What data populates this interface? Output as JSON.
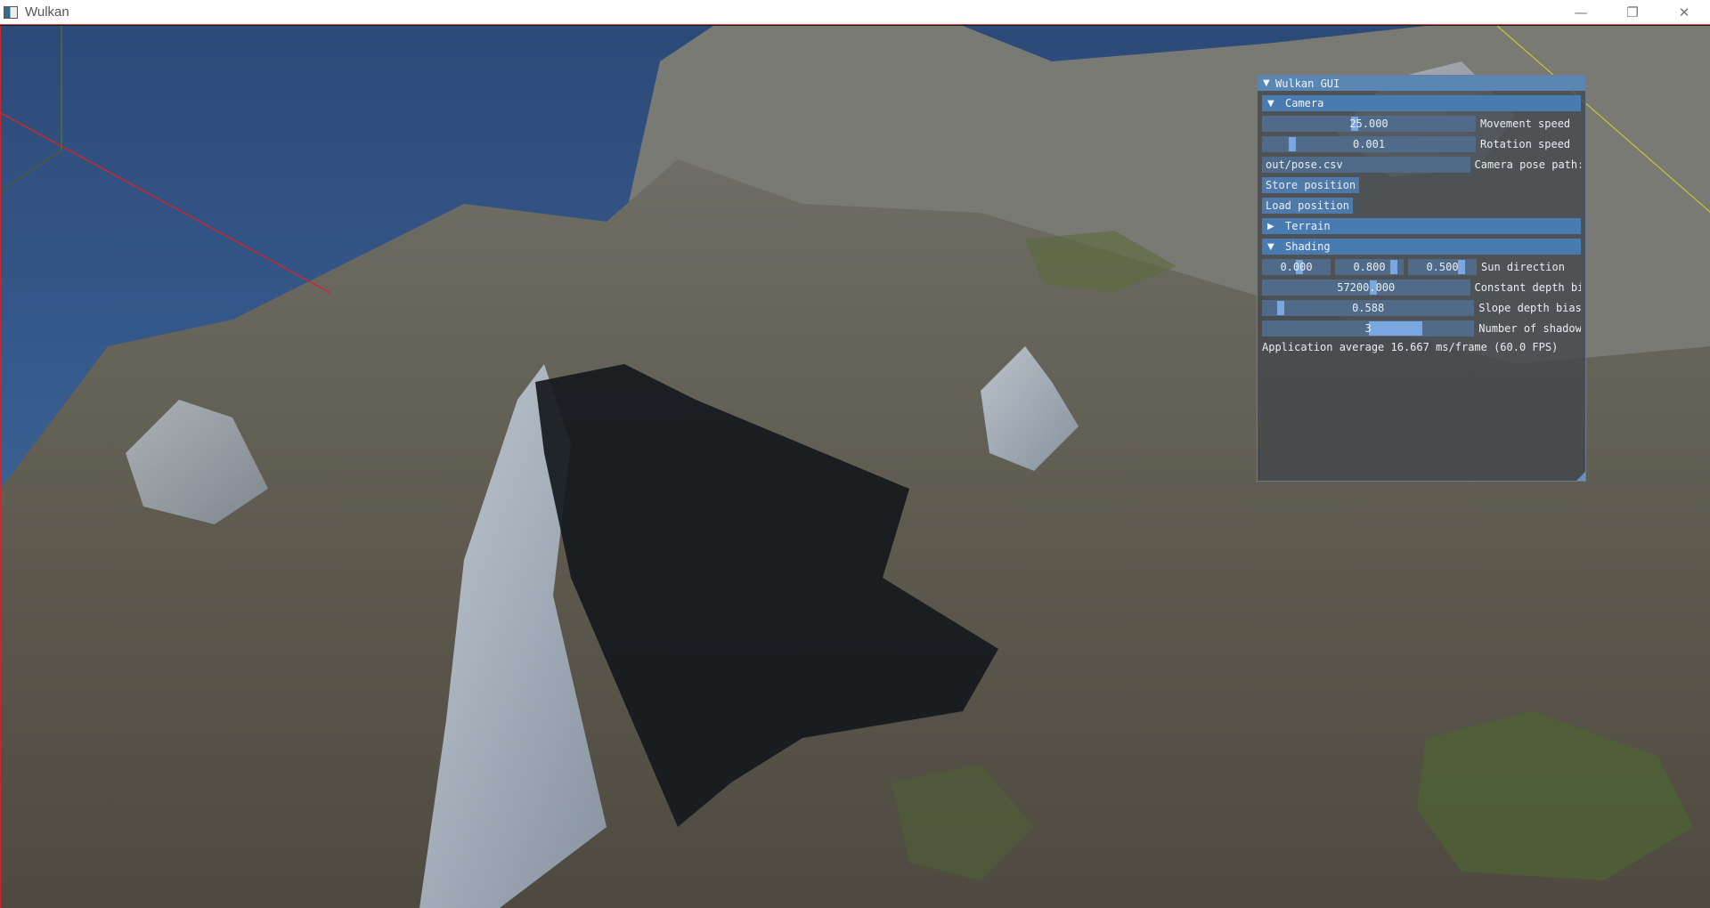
{
  "window": {
    "title": "Wulkan",
    "minimize_glyph": "—",
    "maximize_glyph": "❐",
    "close_glyph": "✕"
  },
  "gui": {
    "title": "Wulkan GUI",
    "expanded_glyph": "▼",
    "collapsed_glyph": "▶",
    "camera": {
      "header": "Camera",
      "movement_speed": {
        "value": "25.000",
        "label": "Movement speed",
        "level": 0.4
      },
      "rotation_speed": {
        "value": "0.001",
        "label": "Rotation speed",
        "level": 0.02
      },
      "pose_path": {
        "value": "out/pose.csv",
        "label": "Camera pose path:"
      },
      "store_button": "Store position",
      "load_button": "Load position"
    },
    "terrain": {
      "header": "Terrain"
    },
    "shading": {
      "header": "Shading",
      "sun_direction": {
        "x": "0.000",
        "y": "0.800",
        "z": "0.500",
        "label": "Sun direction"
      },
      "constant_depth_bias": {
        "value": "57200.000",
        "label": "Constant depth bi"
      },
      "slope_depth_bias": {
        "value": "0.588",
        "label": "Slope depth bias"
      },
      "shadow_count": {
        "value": "3",
        "label": "Number of shadow"
      }
    },
    "stats": "Application average 16.667 ms/frame (60.0 FPS)"
  },
  "colors": {
    "gui_header": "#5a86b4",
    "section_header": "#4a7bb0",
    "frame_bg": "#4f6b89",
    "slider_grab": "#7aa7df",
    "sky": "#35588a",
    "axis_x": "#c8282f",
    "axis_y": "#c8c832"
  }
}
